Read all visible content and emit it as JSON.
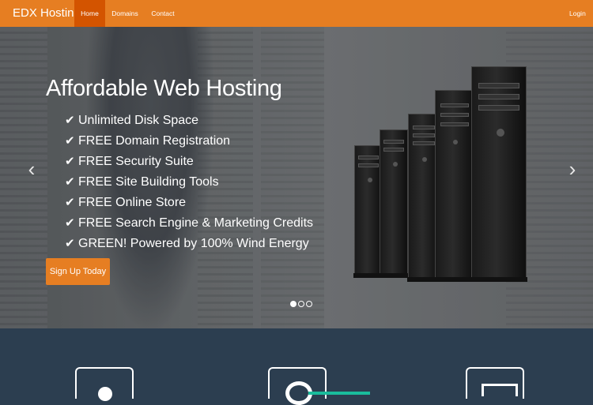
{
  "navbar": {
    "brand": "EDX Hosting",
    "items": [
      {
        "label": "Home",
        "active": true
      },
      {
        "label": "Domains",
        "active": false
      },
      {
        "label": "Contact",
        "active": false
      }
    ],
    "login": "Login"
  },
  "hero": {
    "title": "Affordable Web Hosting",
    "features": [
      "Unlimited Disk Space",
      "FREE Domain Registration",
      "FREE Security Suite",
      "FREE Site Building Tools",
      "FREE Online Store",
      "FREE Search Engine & Marketing Credits",
      "GREEN! Powered by 100% Wind Energy"
    ],
    "cta": "Sign Up Today",
    "prev_arrow": "‹",
    "next_arrow": "›",
    "slides": {
      "count": 3,
      "active_index": 0
    },
    "check_glyph": "✔"
  },
  "icons": [
    "user-icon",
    "globe-icon",
    "screen-icon"
  ],
  "colors": {
    "accent": "#e67e22",
    "accent_active": "#d35400",
    "section_bg": "#2c3e50",
    "green": "#1abc9c"
  }
}
